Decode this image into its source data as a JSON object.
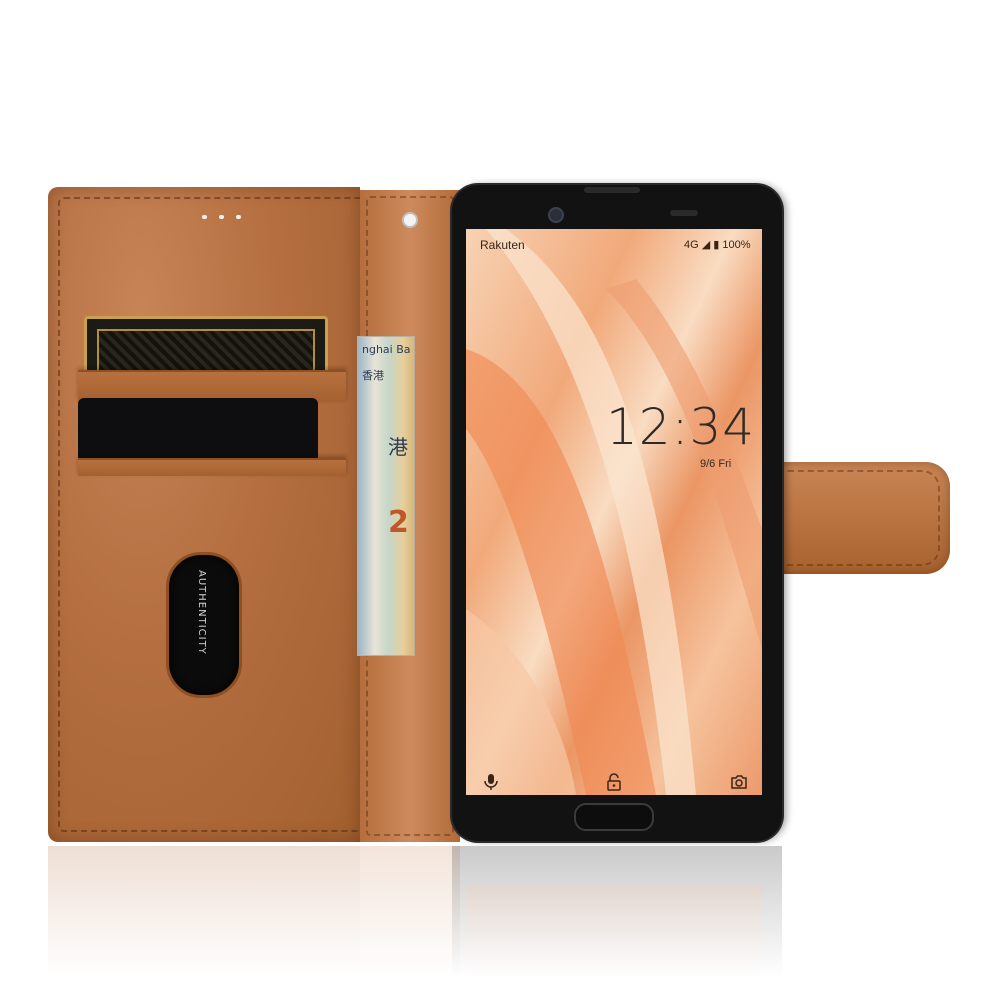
{
  "phone": {
    "carrier": "Rakuten",
    "status_right": "4G ◢ ▮ 100%",
    "time": "12:34",
    "date": "9/6 Fri"
  },
  "card_text": {
    "authentic": "AUTHENTICITY"
  },
  "banknote_text": {
    "line1": "nghai Ba",
    "line2": "香港",
    "line3": "港",
    "line4": "2"
  },
  "colors": {
    "leather": "#b46e40",
    "phone_body": "#121212",
    "wallpaper_accent": "#f1a97a"
  },
  "icons": {
    "left": "microphone-icon",
    "center": "padlock-icon",
    "right": "camera-icon"
  }
}
